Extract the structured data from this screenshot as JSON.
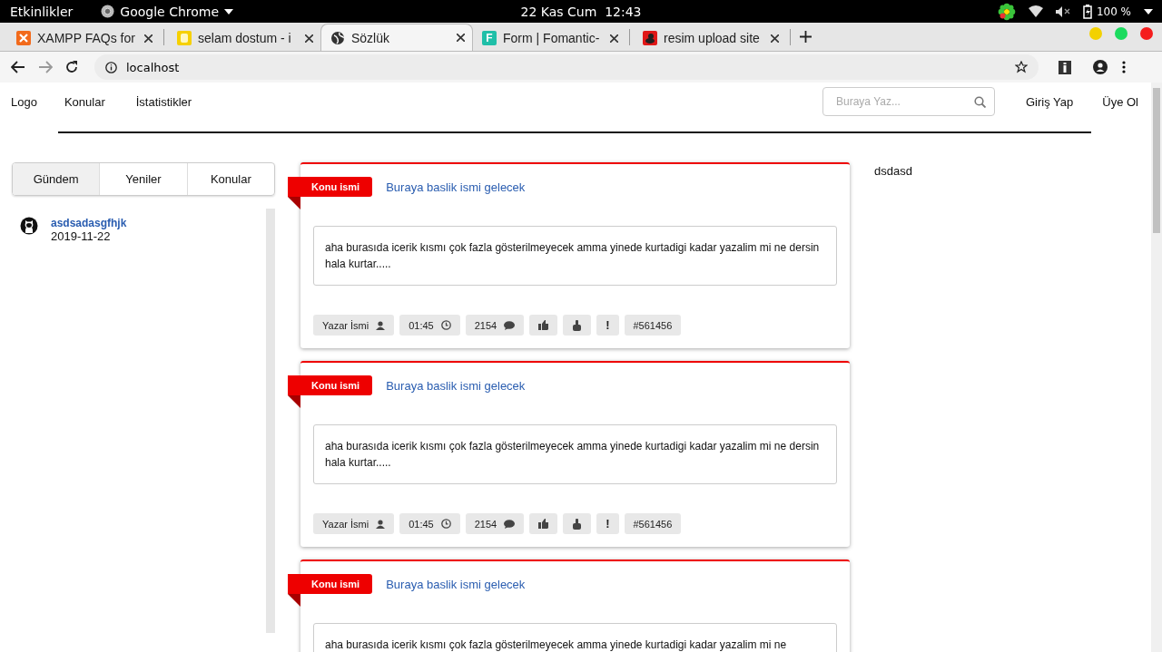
{
  "system_bar": {
    "activities": "Etkinlikler",
    "app": "Google Chrome",
    "clock": "22 Kas Cum  12:43",
    "battery": "100 %"
  },
  "tabs": [
    {
      "kind": "xampp",
      "title": "XAMPP FAQs for",
      "selected": false
    },
    {
      "kind": "yellow",
      "title": "selam dostum - i",
      "selected": false
    },
    {
      "kind": "globe",
      "title": "Sözlük",
      "selected": true
    },
    {
      "kind": "letter",
      "letter": "F",
      "title": "Form | Fomantic-",
      "selected": false
    },
    {
      "kind": "red",
      "title": "resim upload site",
      "selected": false
    }
  ],
  "address_bar": {
    "url": "localhost"
  },
  "site_nav": {
    "logo": "Logo",
    "links": [
      "Konular",
      "İstatistikler"
    ],
    "search": {
      "placeholder": "Buraya Yaz..."
    },
    "actions": [
      "Giriş Yap",
      "Üye Ol"
    ]
  },
  "side_tabs": [
    {
      "label": "Gündem",
      "selected": true
    },
    {
      "label": "Yeniler",
      "selected": false
    },
    {
      "label": "Konular",
      "selected": false
    }
  ],
  "side_items": [
    {
      "title": "asdsadasgfhjk",
      "date": "2019-11-22"
    }
  ],
  "posts": [
    {
      "label": "Konu ismi",
      "title": "Buraya baslik ismi gelecek",
      "content": "aha burasıda icerik kısmı çok fazla gösterilmeyecek amma yinede kurtadigi kadar yazalim mi ne dersin hala kurtar.....",
      "author": "Yazar İsmi",
      "time": "01:45",
      "comments": "2154",
      "report": "!",
      "id": "#561456"
    },
    {
      "label": "Konu ismi",
      "title": "Buraya baslik ismi gelecek",
      "content": "aha burasıda icerik kısmı çok fazla gösterilmeyecek amma yinede kurtadigi kadar yazalim mi ne dersin hala kurtar.....",
      "author": "Yazar İsmi",
      "time": "01:45",
      "comments": "2154",
      "report": "!",
      "id": "#561456"
    },
    {
      "label": "Konu ismi",
      "title": "Buraya baslik ismi gelecek",
      "content": "aha burasıda icerik kısmı çok fazla gösterilmeyecek amma yinede kurtadigi kadar yazalim mi ne"
    }
  ],
  "right_text": "dsdasd"
}
